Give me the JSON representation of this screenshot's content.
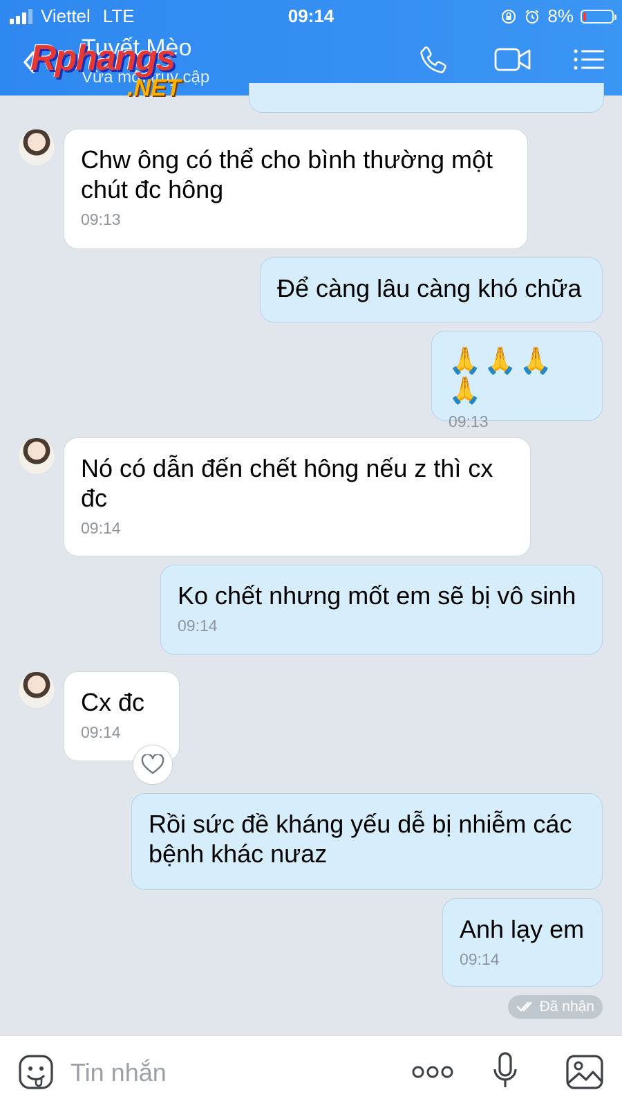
{
  "status_bar": {
    "carrier": "Viettel",
    "network": "LTE",
    "time": "09:14",
    "battery": "8%"
  },
  "header": {
    "contact_name": "Tuyết Mèo",
    "contact_status": "Vừa mới truy cập",
    "watermark_line1": "Rphangs",
    "watermark_line2": ".NET",
    "colors": {
      "header_bg": "#3590f2",
      "incoming_bubble": "#ffffff",
      "outgoing_bubble": "#d6eefb"
    },
    "icons": [
      "back-arrow-icon",
      "phone-icon",
      "video-icon",
      "menu-icon"
    ]
  },
  "messages": [
    {
      "direction": "in",
      "text": "Chw ông có thể cho bình thường một chút đc hông",
      "time": "09:13"
    },
    {
      "direction": "out",
      "text": "Để càng lâu càng khó chữa",
      "time": ""
    },
    {
      "direction": "out",
      "text": "🙏🙏🙏🙏",
      "time": "09:13"
    },
    {
      "direction": "in",
      "text": "Nó có dẫn đến chết hông nếu z thì cx đc",
      "time": "09:14"
    },
    {
      "direction": "out",
      "text": "Ko chết nhưng mốt em sẽ bị vô sinh",
      "time": "09:14"
    },
    {
      "direction": "in",
      "text": "Cx đc",
      "time": "09:14"
    },
    {
      "direction": "out",
      "text": "Rồi sức đề kháng yếu dễ bị nhiễm các bệnh khác nưaz",
      "time": ""
    },
    {
      "direction": "out",
      "text": "Anh lạy em",
      "time": "09:14"
    }
  ],
  "receipt": "Đã nhận",
  "composer": {
    "placeholder": "Tin nhắn"
  }
}
